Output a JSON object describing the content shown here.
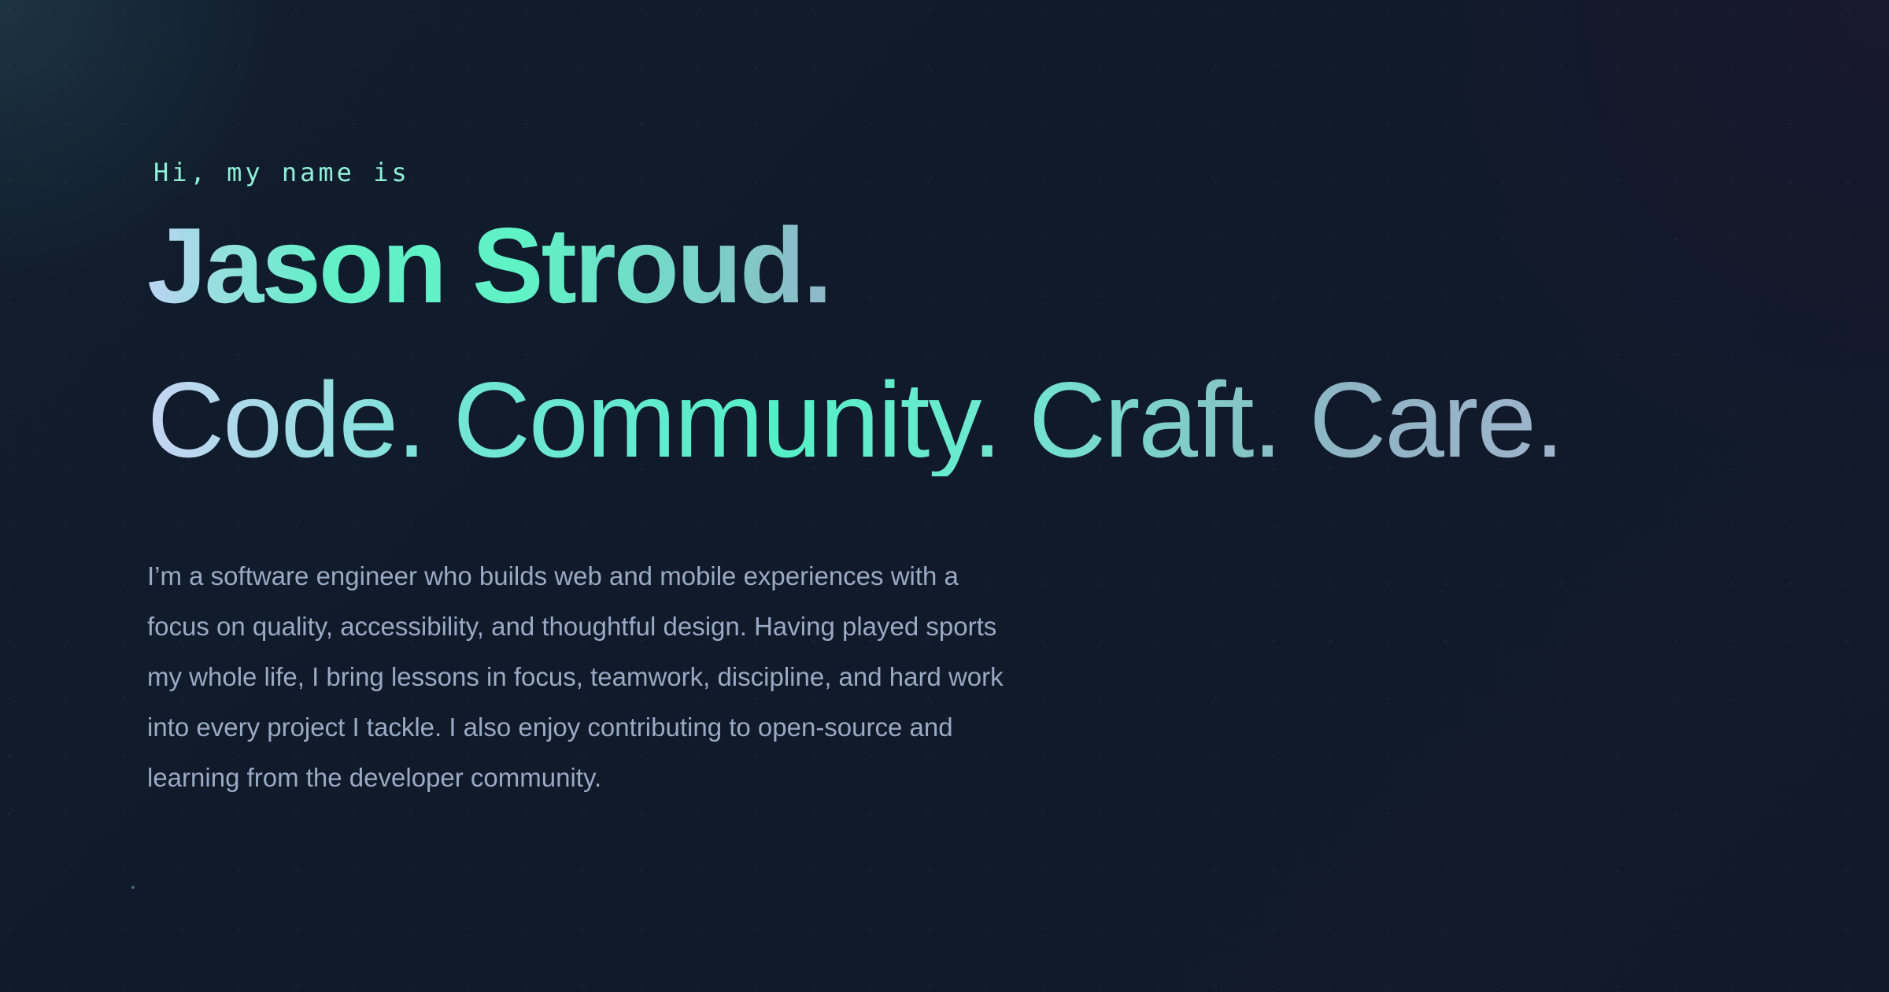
{
  "hero": {
    "greeting": "Hi, my name is",
    "name": "Jason Stroud.",
    "tagline": "Code. Community. Craft. Care.",
    "bio": "I’m a software engineer who builds web and mobile experiences with a focus on quality, accessibility, and thoughtful design. Having played sports my whole life, I bring lessons in focus, teamwork, discipline, and hard work into every project I tackle. I also enjoy contributing to open-source and learning from the developer community."
  },
  "colors": {
    "background": "#0f1a29",
    "accent": "#5ff3c6",
    "greeting": "#8ff0d6",
    "body_text": "#9aa9c4"
  }
}
